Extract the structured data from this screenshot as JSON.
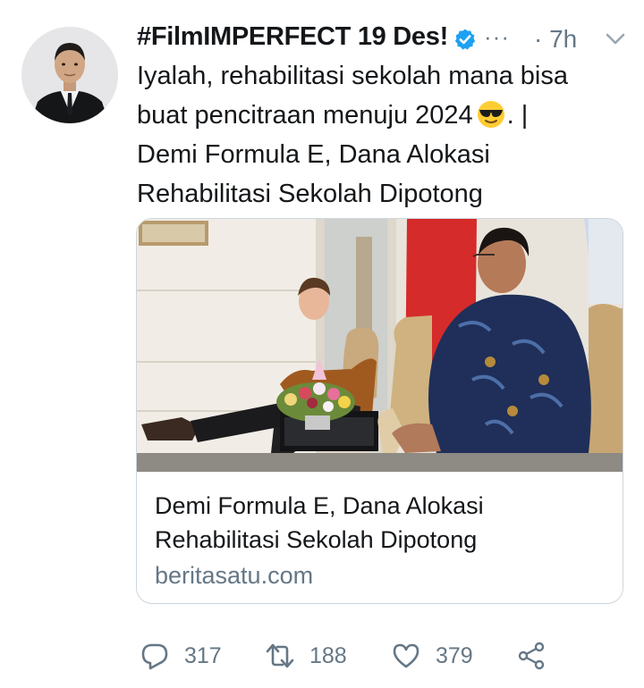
{
  "tweet": {
    "author": {
      "display_name": "#FilmIMPERFECT 19 Des!",
      "verified": true
    },
    "more_label": "···",
    "timestamp": "· 7h",
    "text_lines": [
      "Iyalah, rehabilitasi sekolah mana bisa",
      "buat pencitraan menuju 2024",
      ". |",
      "Demi Formula E, Dana Alokasi",
      "Rehabilitasi Sekolah Dipotong"
    ],
    "emoji": "sunglasses-emoji",
    "card": {
      "title_lines": [
        "Demi Formula E, Dana Alokasi",
        "Rehabilitasi Sekolah Dipotong"
      ],
      "domain": "beritasatu.com"
    },
    "actions": {
      "reply_count": "317",
      "retweet_count": "188",
      "like_count": "379"
    }
  },
  "icons": [
    "verified-badge-icon",
    "chevron-down-icon",
    "reply-icon",
    "retweet-icon",
    "like-icon",
    "share-icon"
  ],
  "colors": {
    "text": "#14171a",
    "secondary": "#657786",
    "verified": "#1da1f2",
    "border": "#ccd6dd"
  }
}
